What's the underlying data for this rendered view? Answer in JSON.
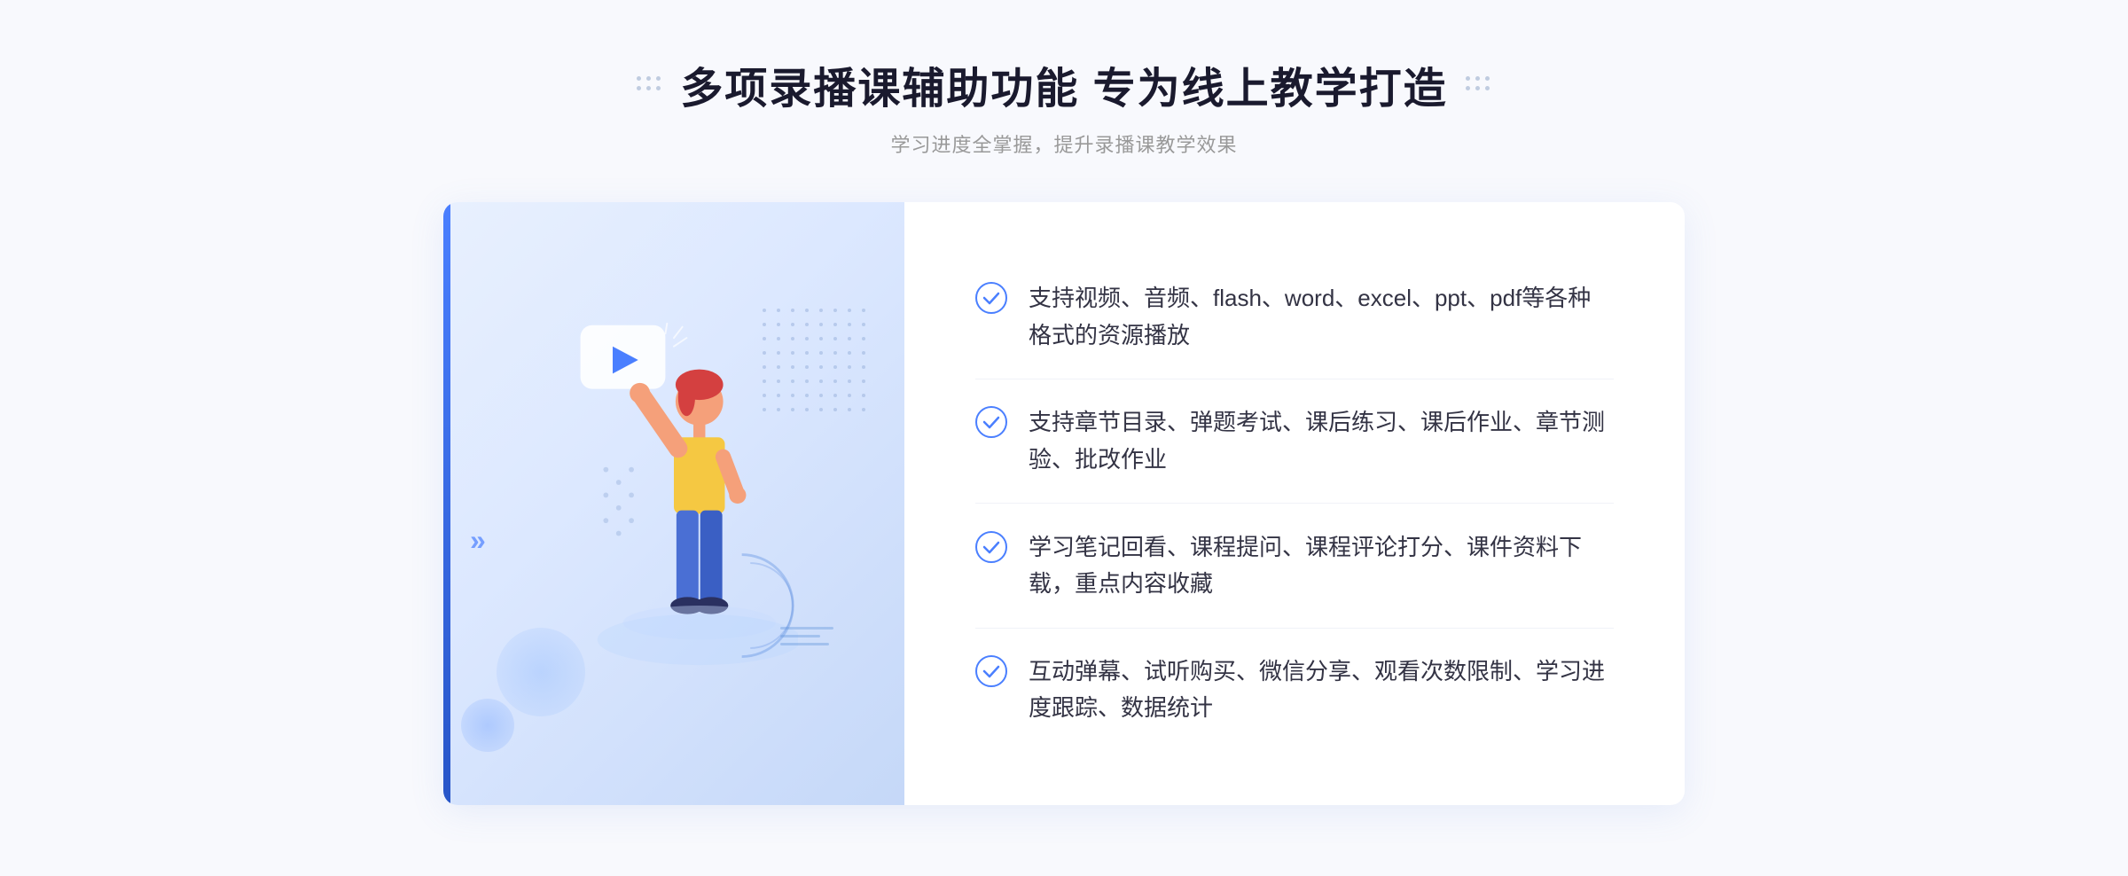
{
  "page": {
    "background": "#f8f9fd"
  },
  "header": {
    "title": "多项录播课辅助功能 专为线上教学打造",
    "subtitle": "学习进度全掌握，提升录播课教学效果"
  },
  "features": [
    {
      "id": "feature-1",
      "text": "支持视频、音频、flash、word、excel、ppt、pdf等各种格式的资源播放"
    },
    {
      "id": "feature-2",
      "text": "支持章节目录、弹题考试、课后练习、课后作业、章节测验、批改作业"
    },
    {
      "id": "feature-3",
      "text": "学习笔记回看、课程提问、课程评论打分、课件资料下载，重点内容收藏"
    },
    {
      "id": "feature-4",
      "text": "互动弹幕、试听购买、微信分享、观看次数限制、学习进度跟踪、数据统计"
    }
  ],
  "icons": {
    "check": "✓",
    "chevrons": "»",
    "play": "▶"
  }
}
